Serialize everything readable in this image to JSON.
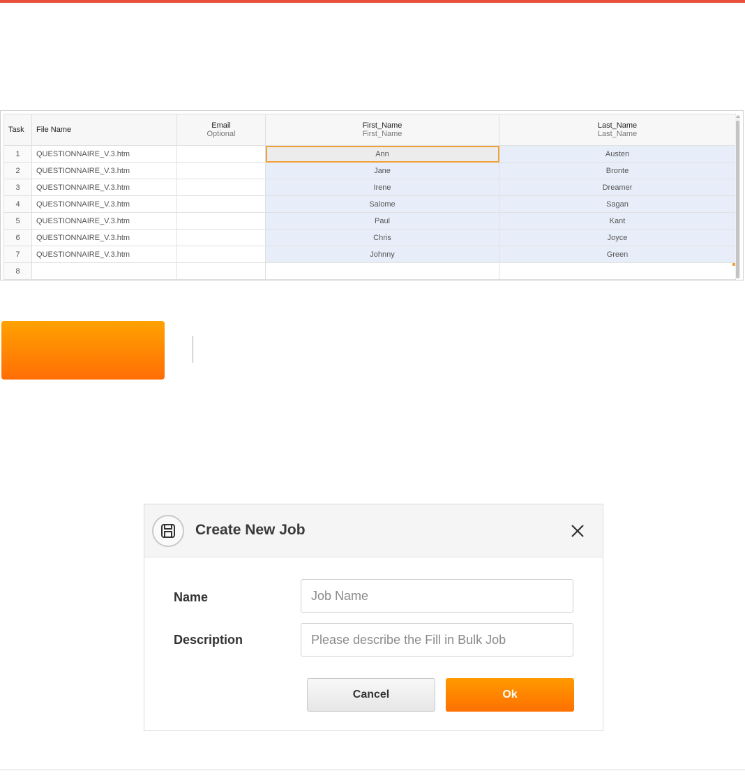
{
  "grid": {
    "columns": [
      {
        "title": "Task"
      },
      {
        "title": "File Name"
      },
      {
        "title": "Email",
        "subtitle": "Optional"
      },
      {
        "title": "First_Name",
        "subtitle": "First_Name"
      },
      {
        "title": "Last_Name",
        "subtitle": "Last_Name"
      }
    ],
    "rows": [
      {
        "task": "1",
        "file": "QUESTIONNAIRE_V.3.htm",
        "email": "",
        "first": "Ann",
        "last": "Austen"
      },
      {
        "task": "2",
        "file": "QUESTIONNAIRE_V.3.htm",
        "email": "",
        "first": "Jane",
        "last": "Bronte"
      },
      {
        "task": "3",
        "file": "QUESTIONNAIRE_V.3.htm",
        "email": "",
        "first": "Irene",
        "last": "Dreamer"
      },
      {
        "task": "4",
        "file": "QUESTIONNAIRE_V.3.htm",
        "email": "",
        "first": "Salome",
        "last": "Sagan"
      },
      {
        "task": "5",
        "file": "QUESTIONNAIRE_V.3.htm",
        "email": "",
        "first": "Paul",
        "last": "Kant"
      },
      {
        "task": "6",
        "file": "QUESTIONNAIRE_V.3.htm",
        "email": "",
        "first": "Chris",
        "last": "Joyce"
      },
      {
        "task": "7",
        "file": "QUESTIONNAIRE_V.3.htm",
        "email": "",
        "first": "Johnny",
        "last": "Green"
      },
      {
        "task": "8",
        "file": "",
        "email": "",
        "first": "",
        "last": ""
      }
    ]
  },
  "dialog": {
    "title": "Create New Job",
    "icon": "save-icon",
    "name_label": "Name",
    "name_placeholder": "Job Name",
    "name_value": "",
    "description_label": "Description",
    "description_placeholder": "Please describe the Fill in Bulk Job",
    "description_value": "",
    "cancel_label": "Cancel",
    "ok_label": "Ok"
  },
  "colors": {
    "accent_orange": "#ff8200",
    "top_bar": "#e94e3b",
    "selection": "#e8eef9"
  }
}
